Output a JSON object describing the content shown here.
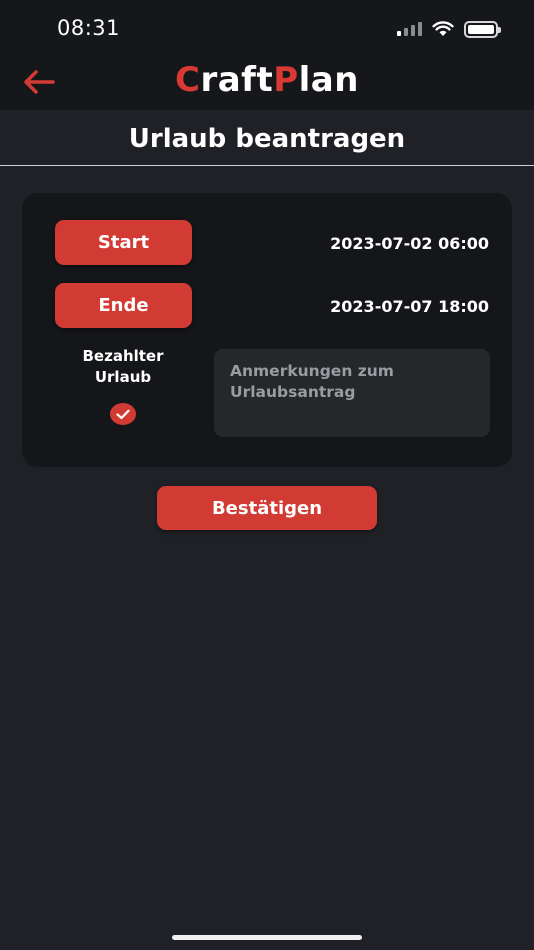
{
  "status_bar": {
    "time": "08:31"
  },
  "header": {
    "brand_first_letter": "C",
    "brand_middle": "raft",
    "brand_second_letter": "P",
    "brand_end": "lan"
  },
  "page": {
    "title": "Urlaub beantragen"
  },
  "form": {
    "start_label": "Start",
    "start_value": "2023-07-02 06:00",
    "end_label": "Ende",
    "end_value": "2023-07-07 18:00",
    "paid_label_line1": "Bezahlter",
    "paid_label_line2": "Urlaub",
    "paid_checked": true,
    "notes_placeholder": "Anmerkungen zum Urlaubsantrag",
    "notes_value": ""
  },
  "actions": {
    "confirm_label": "Bestätigen"
  },
  "colors": {
    "accent": "#d23a34",
    "background": "#1f2126",
    "card": "#15161a"
  }
}
